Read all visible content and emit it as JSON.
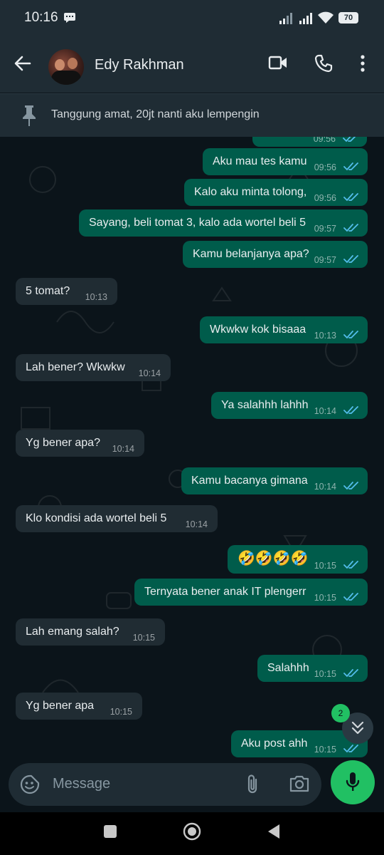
{
  "status_bar": {
    "time": "10:16",
    "battery": "70"
  },
  "header": {
    "contact_name": "Edy Rakhman"
  },
  "pinned": {
    "text": "Tanggung amat, 20jt nanti aku lempengin"
  },
  "partial_top": {
    "time": "09:56"
  },
  "messages": [
    {
      "direction": "out",
      "text": "Aku mau tes kamu",
      "time": "09:56"
    },
    {
      "direction": "out",
      "text": "Kalo aku minta tolong,",
      "time": "09:56"
    },
    {
      "direction": "out",
      "text": "Sayang, beli tomat 3, kalo ada wortel beli 5",
      "time": "09:57"
    },
    {
      "direction": "out",
      "text": "Kamu belanjanya apa?",
      "time": "09:57"
    },
    {
      "direction": "in",
      "text": "5 tomat?",
      "time": "10:13"
    },
    {
      "direction": "out",
      "text": "Wkwkw kok bisaaa",
      "time": "10:13"
    },
    {
      "direction": "in",
      "text": "Lah bener? Wkwkw",
      "time": "10:14"
    },
    {
      "direction": "out",
      "text": "Ya salahhh lahhh",
      "time": "10:14"
    },
    {
      "direction": "in",
      "text": "Yg bener apa?",
      "time": "10:14"
    },
    {
      "direction": "out",
      "text": "Kamu bacanya gimana",
      "time": "10:14"
    },
    {
      "direction": "in",
      "text": "Klo kondisi ada wortel beli 5",
      "time": "10:14"
    },
    {
      "direction": "out",
      "text": "🤣🤣🤣🤣",
      "time": "10:15"
    },
    {
      "direction": "out",
      "text": "Ternyata bener anak IT plengerr",
      "time": "10:15"
    },
    {
      "direction": "in",
      "text": "Lah emang salah?",
      "time": "10:15"
    },
    {
      "direction": "out",
      "text": "Salahhh",
      "time": "10:15"
    },
    {
      "direction": "in",
      "text": "Yg bener apa",
      "time": "10:15"
    },
    {
      "direction": "out",
      "text": "Aku post ahh",
      "time": "10:15"
    }
  ],
  "unread_count": "2",
  "input": {
    "placeholder": "Message"
  },
  "colors": {
    "outgoing_bubble": "#005c4b",
    "incoming_bubble": "#202c33",
    "accent": "#21c063",
    "read_ticks": "#53bdeb"
  },
  "icons": [
    "back-arrow-icon",
    "video-call-icon",
    "voice-call-icon",
    "more-options-icon",
    "pin-icon",
    "read-receipt-icon",
    "chevron-down-icon",
    "emoji-icon",
    "attach-icon",
    "camera-icon",
    "mic-icon",
    "nav-recents-icon",
    "nav-home-icon",
    "nav-back-icon"
  ]
}
